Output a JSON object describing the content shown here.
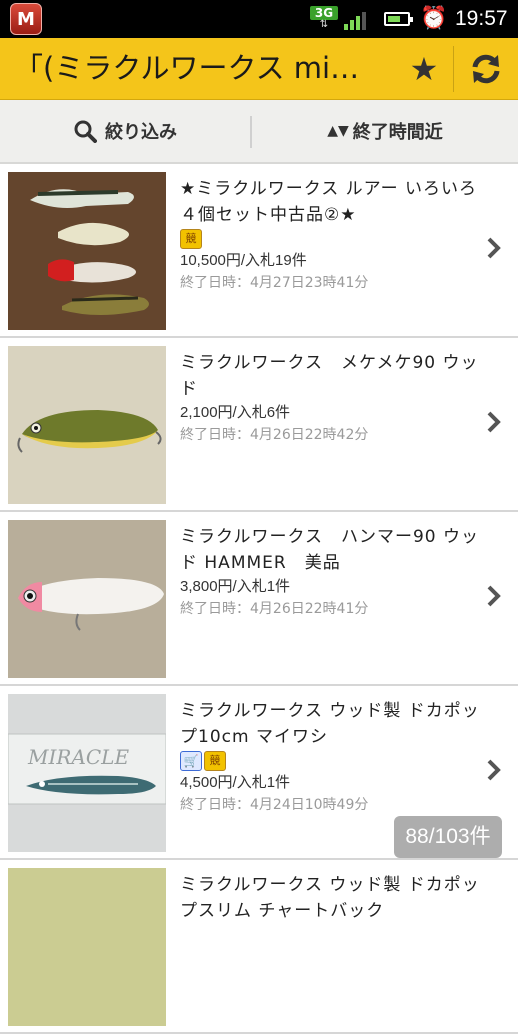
{
  "status_bar": {
    "network": "3G",
    "time": "19:57"
  },
  "app_bar": {
    "title": "「(ミラクルワークス mi…"
  },
  "filter_bar": {
    "filter_label": "絞り込み",
    "sort_label": "終了時間近"
  },
  "items": [
    {
      "name": "★ミラクルワークス ルアー いろいろ　４個セット中古品②★",
      "badges": [
        "auction-badge"
      ],
      "price": "10,500円/入札19件",
      "end_time": "終了日時：4月27日23時41分"
    },
    {
      "name": "ミラクルワークス　メケメケ90 ウッド",
      "badges": [],
      "price": "2,100円/入札6件",
      "end_time": "終了日時：4月26日22時42分"
    },
    {
      "name": "ミラクルワークス　ハンマー90 ウッド HAMMER　美品",
      "badges": [],
      "price": "3,800円/入札1件",
      "end_time": "終了日時：4月26日22時41分"
    },
    {
      "name": "ミラクルワークス ウッド製 ドカポップ10cm マイワシ",
      "badges": [
        "cart-badge",
        "auction-badge"
      ],
      "price": "4,500円/入札1件",
      "end_time": "終了日時：4月24日10時49分"
    },
    {
      "name": "ミラクルワークス ウッド製 ドカポップスリム チャートバック",
      "badges": [],
      "price": "",
      "end_time": ""
    }
  ],
  "counter": "88/103件",
  "colors": {
    "app_bar": "#f4c51a",
    "filter_bar": "#efefed",
    "price_text": "#333333",
    "muted_text": "#9a9a9a"
  }
}
